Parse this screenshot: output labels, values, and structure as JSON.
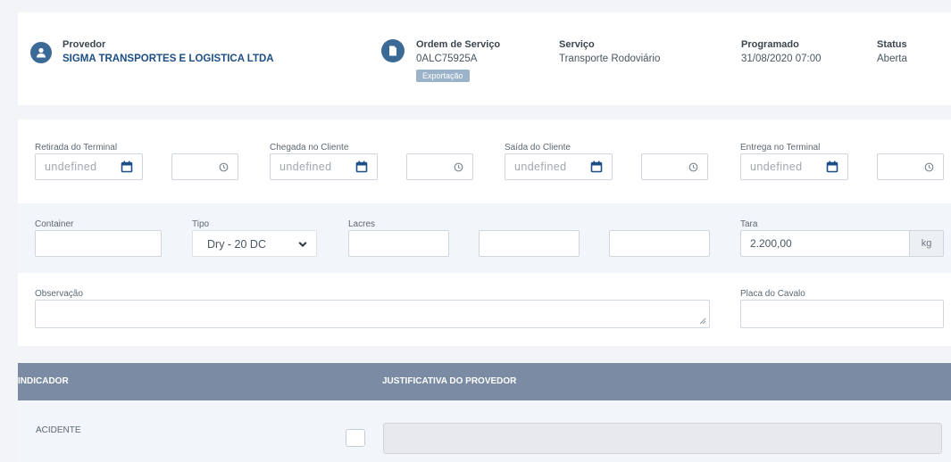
{
  "header": {
    "provider_label": "Provedor",
    "provider_name": "SIGMA TRANSPORTES E LOGISTICA LTDA",
    "order_label": "Ordem de Serviço",
    "order_number": "0ALC75925A",
    "order_badge": "Exportação",
    "service_label": "Serviço",
    "service_value": "Transporte Rodoviário",
    "scheduled_label": "Programado",
    "scheduled_value": "31/08/2020 07:00",
    "status_label": "Status",
    "status_value": "Aberta"
  },
  "dates": {
    "terminal_pickup_label": "Retirada do Terminal",
    "client_arrival_label": "Chegada no Cliente",
    "client_departure_label": "Saída do Cliente",
    "terminal_delivery_label": "Entrega no Terminal",
    "date_placeholder": "undefined"
  },
  "container": {
    "container_label": "Container",
    "container_value": "",
    "type_label": "Tipo",
    "type_value": "Dry - 20 DC",
    "seals_label": "Lacres",
    "tare_label": "Tara",
    "tare_value": "2.200,00",
    "tare_unit": "kg"
  },
  "notes": {
    "observation_label": "Observação",
    "plate_label": "Placa do Cavalo"
  },
  "table": {
    "col_indicator": "INDICADOR",
    "col_justification": "JUSTIFICATIVA DO PROVEDOR",
    "rows": [
      {
        "indicator": "ACIDENTE",
        "checked": false,
        "justification": ""
      }
    ]
  },
  "colors": {
    "accent": "#1b4f86",
    "table_header": "#7b8ba3",
    "badge": "#9bb3c8"
  },
  "icons": [
    "user-icon",
    "document-icon",
    "calendar-icon",
    "clock-icon",
    "chevron-down-icon",
    "resize-handle-icon"
  ]
}
